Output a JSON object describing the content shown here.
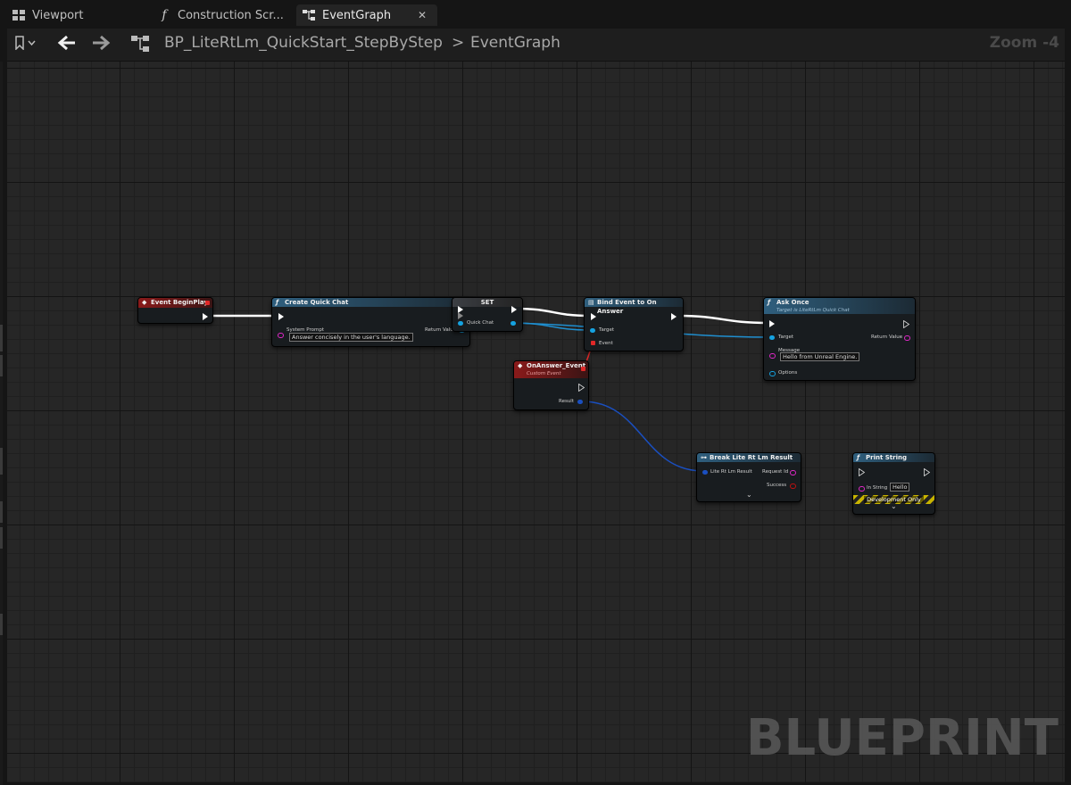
{
  "tabs": [
    {
      "label": "Viewport",
      "icon": "viewport-icon"
    },
    {
      "label": "Construction Scr...",
      "icon": "function-icon"
    },
    {
      "label": "EventGraph",
      "icon": "graph-icon",
      "active": true
    }
  ],
  "toolbar": {
    "breadcrumb_asset": "BP_LiteRtLm_QuickStart_StepByStep",
    "breadcrumb_sep": ">",
    "breadcrumb_graph": "EventGraph",
    "zoom": "Zoom -4"
  },
  "nodes": {
    "begin_play": {
      "title": "Event BeginPlay"
    },
    "create_chat": {
      "title": "Create Quick Chat",
      "system_prompt_label": "System Prompt",
      "system_prompt_value": "Answer concisely in the user's language.",
      "return_label": "Return Value"
    },
    "set": {
      "title": "SET",
      "quick_chat_label": "Quick Chat"
    },
    "bind_event": {
      "title": "Bind Event to On Answer",
      "target_label": "Target",
      "event_label": "Event"
    },
    "ask_once": {
      "title": "Ask Once",
      "subtitle": "Target is LiteRtLm Quick Chat",
      "target_label": "Target",
      "return_label": "Return Value",
      "message_label": "Message",
      "message_value": "Hello from Unreal Engine.",
      "options_label": "Options"
    },
    "on_answer": {
      "title": "OnAnswer_Event",
      "subtitle": "Custom Event",
      "result_label": "Result"
    },
    "break_result": {
      "title": "Break Lite Rt Lm Result",
      "input_label": "Lite Rt Lm Result",
      "request_label": "Request Id",
      "success_label": "Success"
    },
    "print_string": {
      "title": "Print String",
      "instring_label": "In String",
      "instring_value": "Hello",
      "dev_only": "Development Only"
    }
  },
  "watermark": "BLUEPRINT",
  "colors": {
    "exec": "#ffffff",
    "object": "#15a2e0",
    "string": "#e028c8",
    "delegate": "#e02828",
    "background": "#262626"
  }
}
